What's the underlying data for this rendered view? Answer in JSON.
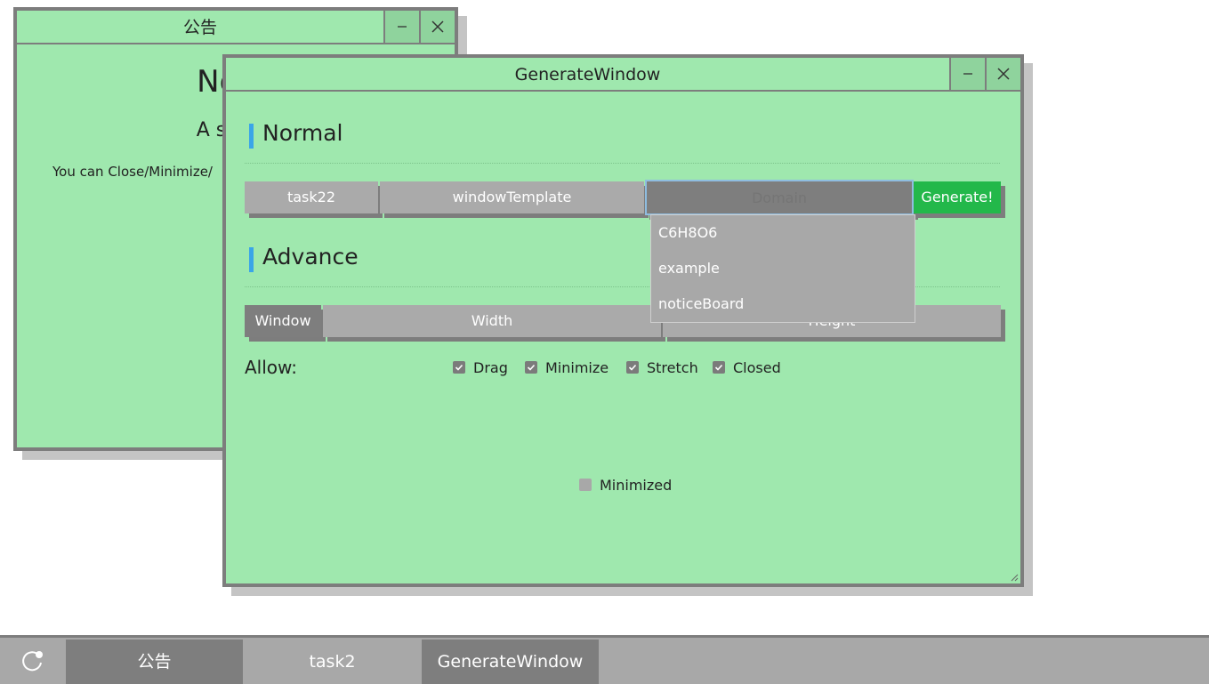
{
  "notice_window": {
    "title": "公告",
    "heading": "Notic",
    "subheading": "A sampl",
    "body": "You can Close/Minimize/"
  },
  "generate_window": {
    "title": "GenerateWindow",
    "normal_section": "Normal",
    "advance_section": "Advance",
    "task_field": "task22",
    "template_field": "windowTemplate",
    "domain_field": "Domain",
    "generate_label": "Generate!",
    "domain_options": [
      "C6H8O6",
      "example",
      "noticeBoard"
    ],
    "window_label": "Window",
    "width_field": "Width",
    "height_field": "Height",
    "allow_label": "Allow:",
    "options": [
      {
        "label": "Drag",
        "checked": true
      },
      {
        "label": "Minimize",
        "checked": true
      },
      {
        "label": "Stretch",
        "checked": true
      },
      {
        "label": "Closed",
        "checked": true
      }
    ],
    "minimized_label": "Minimized",
    "minimized_checked": false
  },
  "taskbar": {
    "start_icon": "refresh-dot-icon",
    "tasks": [
      {
        "label": "公告",
        "active": true
      },
      {
        "label": "task2",
        "active": false
      },
      {
        "label": "GenerateWindow",
        "active": true
      }
    ]
  },
  "colors": {
    "window_bg": "#9fe8ae",
    "border": "#7d7d7d",
    "accent": "#3aa5e8",
    "generate": "#23b84a",
    "field": "#aaaaaa"
  }
}
